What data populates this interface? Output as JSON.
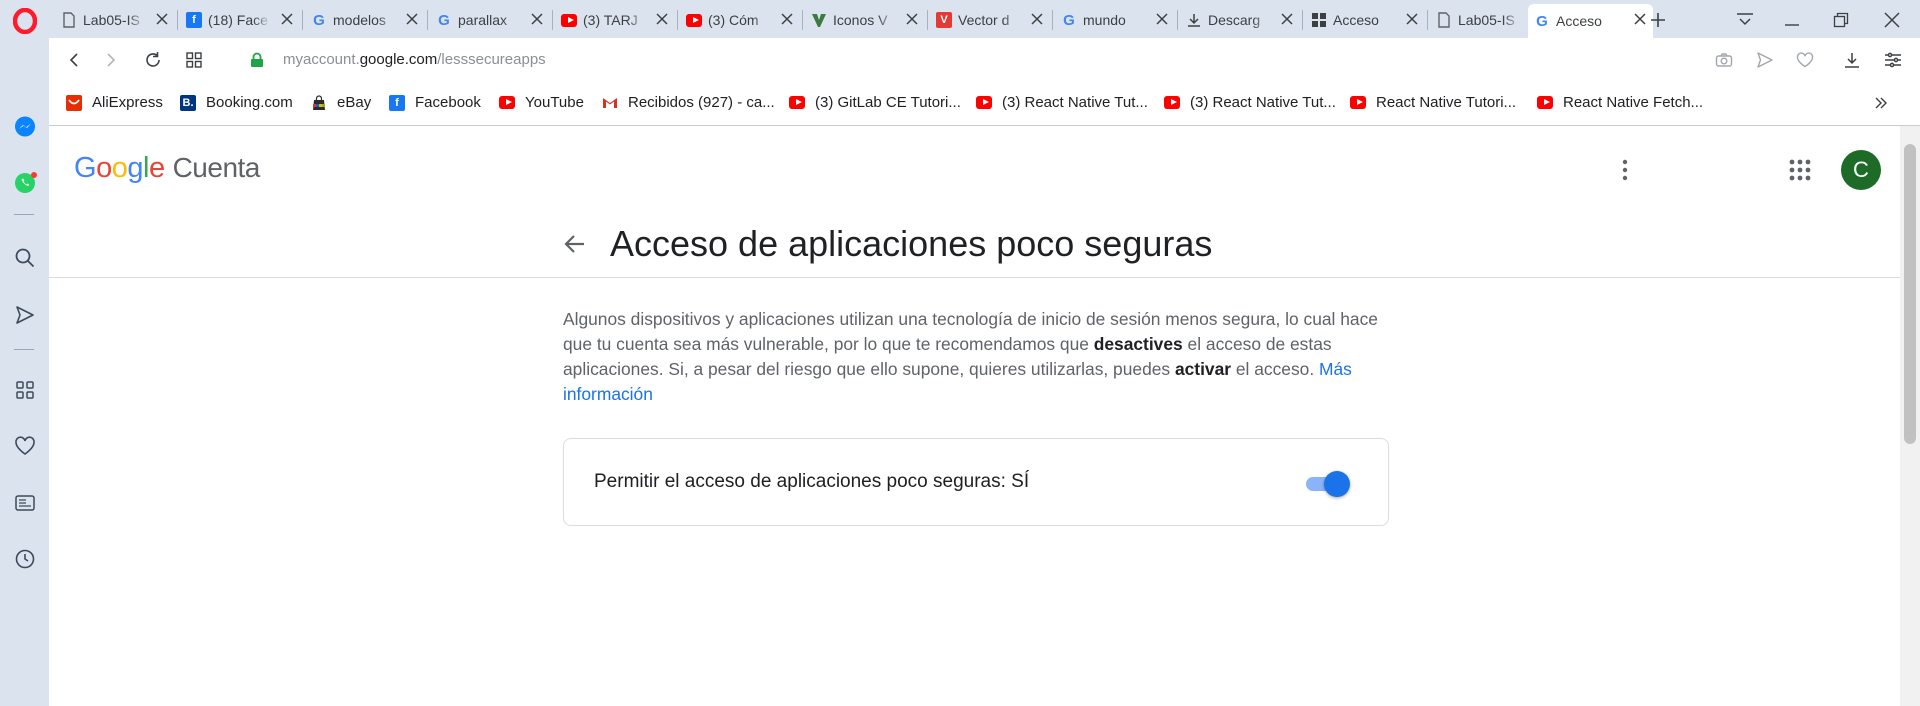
{
  "tabs": [
    {
      "title": "Lab05-IS",
      "icon": "document-icon"
    },
    {
      "title": "(18) Face",
      "icon": "facebook-icon"
    },
    {
      "title": "modelos",
      "icon": "google-icon"
    },
    {
      "title": "parallax",
      "icon": "google-icon"
    },
    {
      "title": "(3) TARJ",
      "icon": "youtube-icon"
    },
    {
      "title": "(3) Cóm",
      "icon": "youtube-icon"
    },
    {
      "title": "Iconos V",
      "icon": "vector-icon"
    },
    {
      "title": "Vector d",
      "icon": "vector-red-icon"
    },
    {
      "title": "mundo",
      "icon": "google-icon"
    },
    {
      "title": "Descarg",
      "icon": "download-icon"
    },
    {
      "title": "Acceso",
      "icon": "apps-grid-icon"
    },
    {
      "title": "Lab05-IS",
      "icon": "document-icon"
    },
    {
      "title": "Acceso",
      "icon": "google-icon"
    }
  ],
  "address": {
    "url_prefix": "myaccount.",
    "url_domain": "google.com",
    "url_path": "/lesssecureapps"
  },
  "bookmarks": [
    {
      "label": "AliExpress",
      "icon": "aliexpress-icon"
    },
    {
      "label": "Booking.com",
      "icon": "booking-icon"
    },
    {
      "label": "eBay",
      "icon": "ebay-icon"
    },
    {
      "label": "Facebook",
      "icon": "facebook-icon"
    },
    {
      "label": "YouTube",
      "icon": "youtube-icon"
    },
    {
      "label": "Recibidos (927) - ca...",
      "icon": "gmail-icon"
    },
    {
      "label": "(3) GitLab CE Tutori...",
      "icon": "youtube-icon"
    },
    {
      "label": "(3) React Native Tut...",
      "icon": "youtube-icon"
    },
    {
      "label": "(3) React Native Tut...",
      "icon": "youtube-icon"
    },
    {
      "label": "React Native Tutori...",
      "icon": "youtube-icon"
    },
    {
      "label": "React Native Fetch...",
      "icon": "youtube-icon"
    }
  ],
  "header": {
    "logo_letters": [
      "G",
      "o",
      "o",
      "g",
      "l",
      "e"
    ],
    "logo_colors": [
      "#4285F4",
      "#EA4335",
      "#FBBC05",
      "#4285F4",
      "#34A853",
      "#EA4335"
    ],
    "product": "Cuenta",
    "avatar_letter": "C"
  },
  "main": {
    "title": "Acceso de aplicaciones poco seguras",
    "desc_part1": "Algunos dispositivos y aplicaciones utilizan una tecnología de inicio de sesión menos segura, lo cual hace que tu cuenta sea más vulnerable, por lo que te recomendamos que ",
    "desc_bold1": "desactives",
    "desc_part2": " el acceso de estas aplicaciones. Si, a pesar del riesgo que ello supone, quieres utilizarlas, puedes ",
    "desc_bold2": "activar",
    "desc_part3": " el acceso. ",
    "desc_link": "Más información",
    "setting_label": "Permitir el acceso de aplicaciones poco seguras: SÍ",
    "toggle_on": true
  },
  "colors": {
    "accent": "#1a73e8",
    "toggle_track": "#8ab4f8",
    "avatar_bg": "#1e6b27",
    "opera_red": "#ff1b2d"
  }
}
